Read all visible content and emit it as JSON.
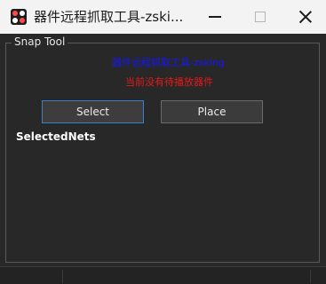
{
  "window": {
    "title": "器件远程抓取工具-zski...",
    "icon": "app-icon"
  },
  "group": {
    "title": "Snap Tool"
  },
  "main": {
    "heading": "器件远程抓取工具-zsking",
    "status": "当前没有待播放器件",
    "select_label": "Select",
    "place_label": "Place",
    "nets_label": "SelectedNets"
  },
  "colors": {
    "heading": "#1515ff",
    "status": "#e41a1a",
    "select_border": "#3d7ec9"
  }
}
